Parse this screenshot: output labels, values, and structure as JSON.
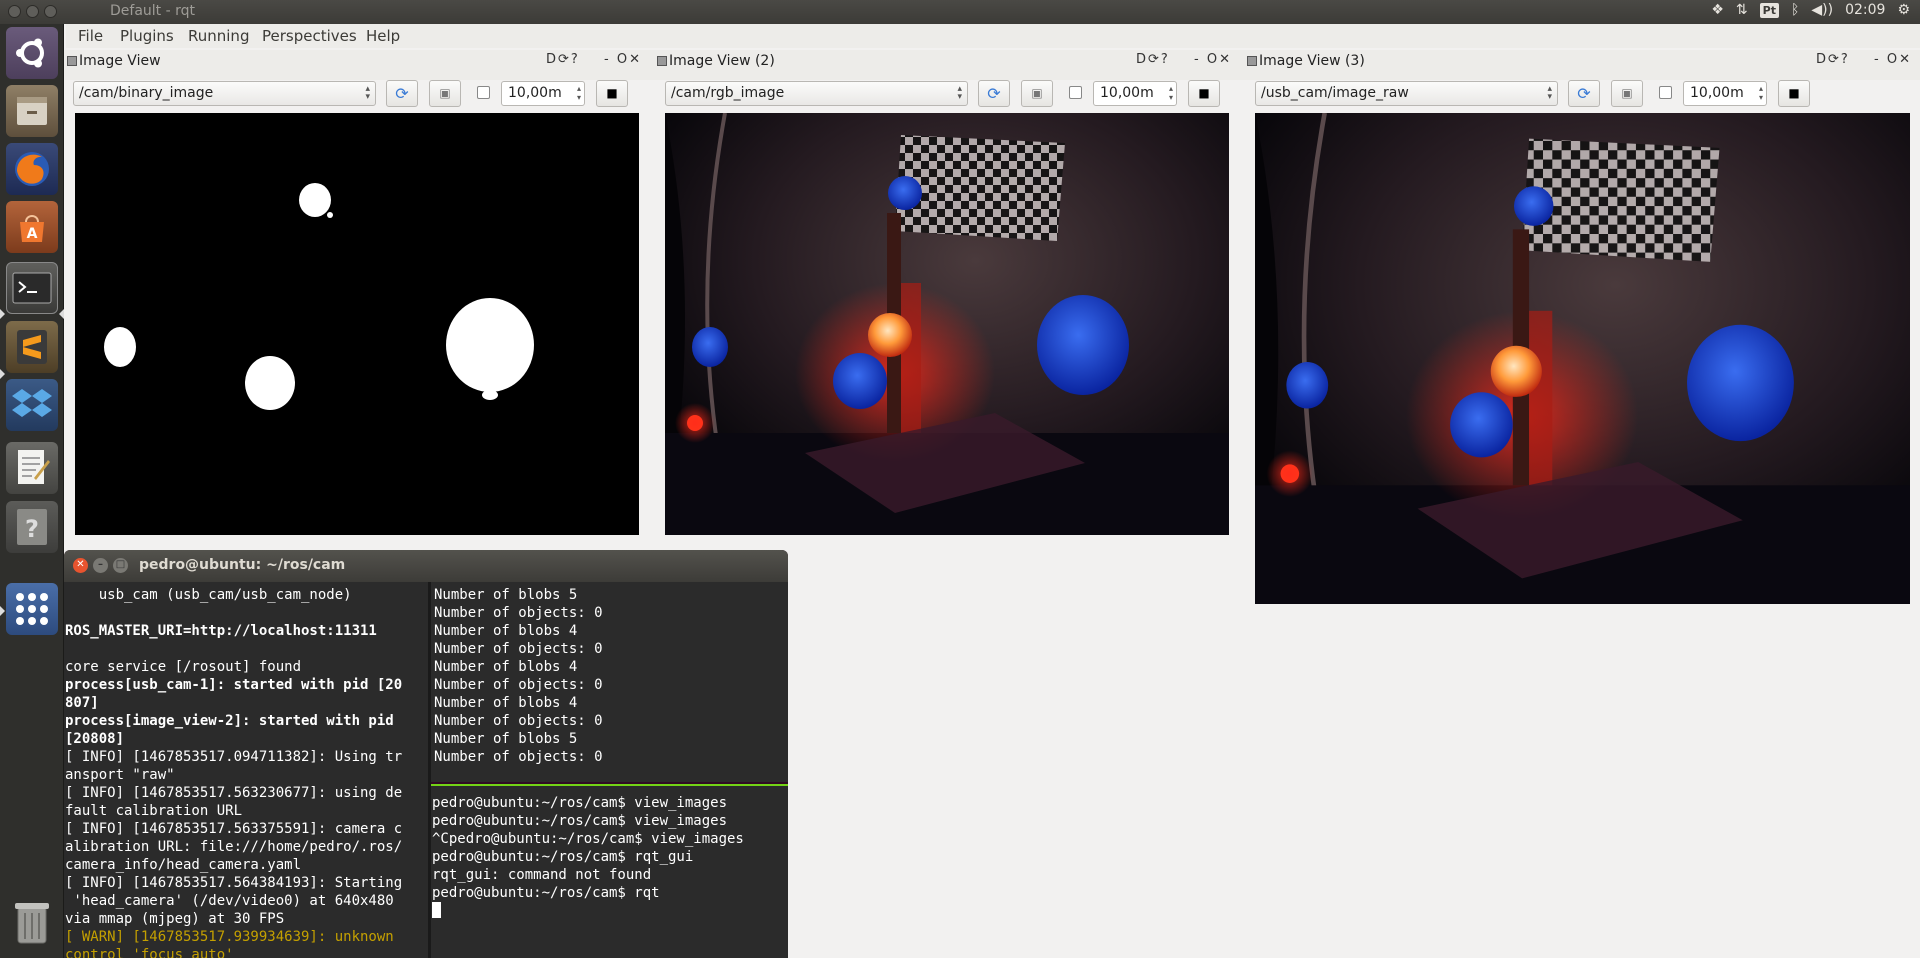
{
  "window": {
    "title": "Default - rqt"
  },
  "tray": {
    "layout": "Pt",
    "clock": "02:09",
    "icons": [
      "dropbox-icon",
      "network-icon",
      "bluetooth-icon",
      "volume-icon"
    ]
  },
  "menu": {
    "items": [
      "File",
      "Plugins",
      "Running",
      "Perspectives",
      "Help"
    ]
  },
  "launcher": {
    "icons": [
      "ubuntu-logo-icon",
      "files-icon",
      "firefox-icon",
      "software-center-icon",
      "terminal-icon",
      "sublime-icon",
      "dropbox-icon",
      "text-editor-icon",
      "help-icon",
      "workspaces-icon",
      "trash-icon"
    ]
  },
  "panels": [
    {
      "title": "Image View",
      "topic": "/cam/binary_image",
      "zoom": "10,00m",
      "controls": "D",
      "close": "- O"
    },
    {
      "title": "Image View (2)",
      "topic": "/cam/rgb_image",
      "zoom": "10,00m",
      "controls": "D",
      "close": "- O"
    },
    {
      "title": "Image View (3)",
      "topic": "/usb_cam/image_raw",
      "zoom": "10,00m",
      "controls": "D",
      "close": "- O"
    }
  ],
  "terminal": {
    "title": "pedro@ubuntu: ~/ros/cam",
    "left_lines": [
      {
        "text": "    usb_cam (usb_cam/usb_cam_node)",
        "style": ""
      },
      {
        "text": "",
        "style": ""
      },
      {
        "text": "ROS_MASTER_URI=http://localhost:11311",
        "style": "b"
      },
      {
        "text": "",
        "style": ""
      },
      {
        "text": "core service [/rosout] found",
        "style": ""
      },
      {
        "text": "process[usb_cam-1]: started with pid [20",
        "style": "b"
      },
      {
        "text": "807]",
        "style": "b"
      },
      {
        "text": "process[image_view-2]: started with pid",
        "style": "b"
      },
      {
        "text": "[20808]",
        "style": "b"
      },
      {
        "text": "[ INFO] [1467853517.094711382]: Using tr",
        "style": ""
      },
      {
        "text": "ansport \"raw\"",
        "style": ""
      },
      {
        "text": "[ INFO] [1467853517.563230677]: using de",
        "style": ""
      },
      {
        "text": "fault calibration URL",
        "style": ""
      },
      {
        "text": "[ INFO] [1467853517.563375591]: camera c",
        "style": ""
      },
      {
        "text": "alibration URL: file:///home/pedro/.ros/",
        "style": ""
      },
      {
        "text": "camera_info/head_camera.yaml",
        "style": ""
      },
      {
        "text": "[ INFO] [1467853517.564384193]: Starting",
        "style": ""
      },
      {
        "text": " 'head_camera' (/dev/video0) at 640x480",
        "style": ""
      },
      {
        "text": "via mmap (mjpeg) at 30 FPS",
        "style": ""
      },
      {
        "text": "[ WARN] [1467853517.939934639]: unknown",
        "style": "warn"
      },
      {
        "text": "control 'focus_auto'",
        "style": "warn"
      }
    ],
    "right_top_lines": [
      "Number of blobs 5",
      "Number of objects: 0",
      "Number of blobs 4",
      "Number of objects: 0",
      "Number of blobs 4",
      "Number of objects: 0",
      "Number of blobs 4",
      "Number of objects: 0",
      "Number of blobs 5",
      "Number of objects: 0"
    ],
    "right_bottom_lines": [
      "pedro@ubuntu:~/ros/cam$ view_images",
      "pedro@ubuntu:~/ros/cam$ view_images",
      "^Cpedro@ubuntu:~/ros/cam$ view_images",
      "pedro@ubuntu:~/ros/cam$ rqt_gui",
      "rqt_gui: command not found",
      "pedro@ubuntu:~/ros/cam$ rqt"
    ]
  }
}
